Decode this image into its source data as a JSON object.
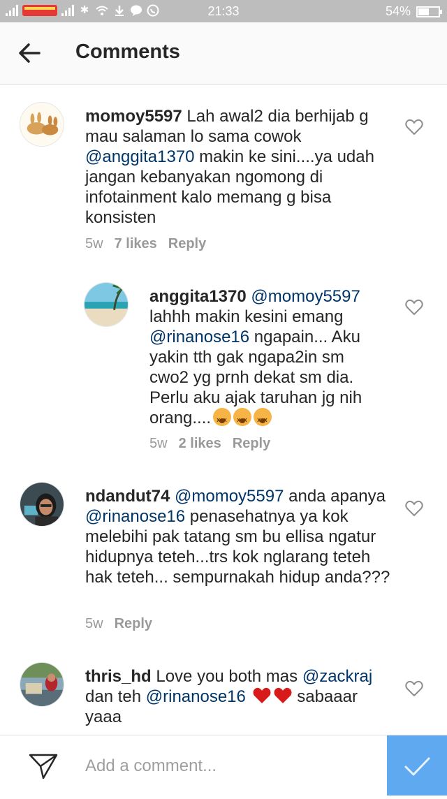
{
  "status": {
    "time": "21:33",
    "battery": "54%",
    "carrier_logo_text": "SMARTFREN"
  },
  "header": {
    "title": "Comments"
  },
  "comments": [
    {
      "username": "momoy5597",
      "text_1": " Lah awal2 dia berhijab g mau salaman lo sama cowok ",
      "mention_1": "@anggita1370",
      "text_2": " makin ke sini....ya udah jangan kebanyakan ngomong di infotainment kalo memang g bisa konsisten",
      "time": "5w",
      "likes": "7 likes",
      "reply": "Reply"
    },
    {
      "username": "anggita1370",
      "mention_1": "@momoy5597",
      "text_1": " lahhh makin kesini emang ",
      "mention_2": "@rinanose16",
      "text_2": " ngapain... Aku yakin tth gak ngapa2in sm cwo2 yg prnh dekat sm dia. Perlu aku ajak taruhan jg nih orang....",
      "time": "5w",
      "likes": "2 likes",
      "reply": "Reply"
    },
    {
      "username": "ndandut74",
      "mention_1": "@momoy5597",
      "text_1": " anda apanya ",
      "mention_2": "@rinanose16",
      "text_2": " penasehatnya ya kok melebihi pak tatang sm bu ellisa ngatur hidupnya teteh...trs kok nglarang teteh hak teteh... sempurnakah hidup anda???",
      "time": "5w",
      "reply": "Reply"
    },
    {
      "username": "thris_hd",
      "text_1": " Love you both mas ",
      "mention_1": "@zackraj",
      "text_2": " dan teh ",
      "mention_2": "@rinanose16",
      "text_3": " sabaaar yaaa"
    }
  ],
  "composer": {
    "placeholder": "Add a comment..."
  },
  "colors": {
    "mention": "#003569",
    "post_button": "#5ea9ef",
    "meta_text": "#999999"
  }
}
